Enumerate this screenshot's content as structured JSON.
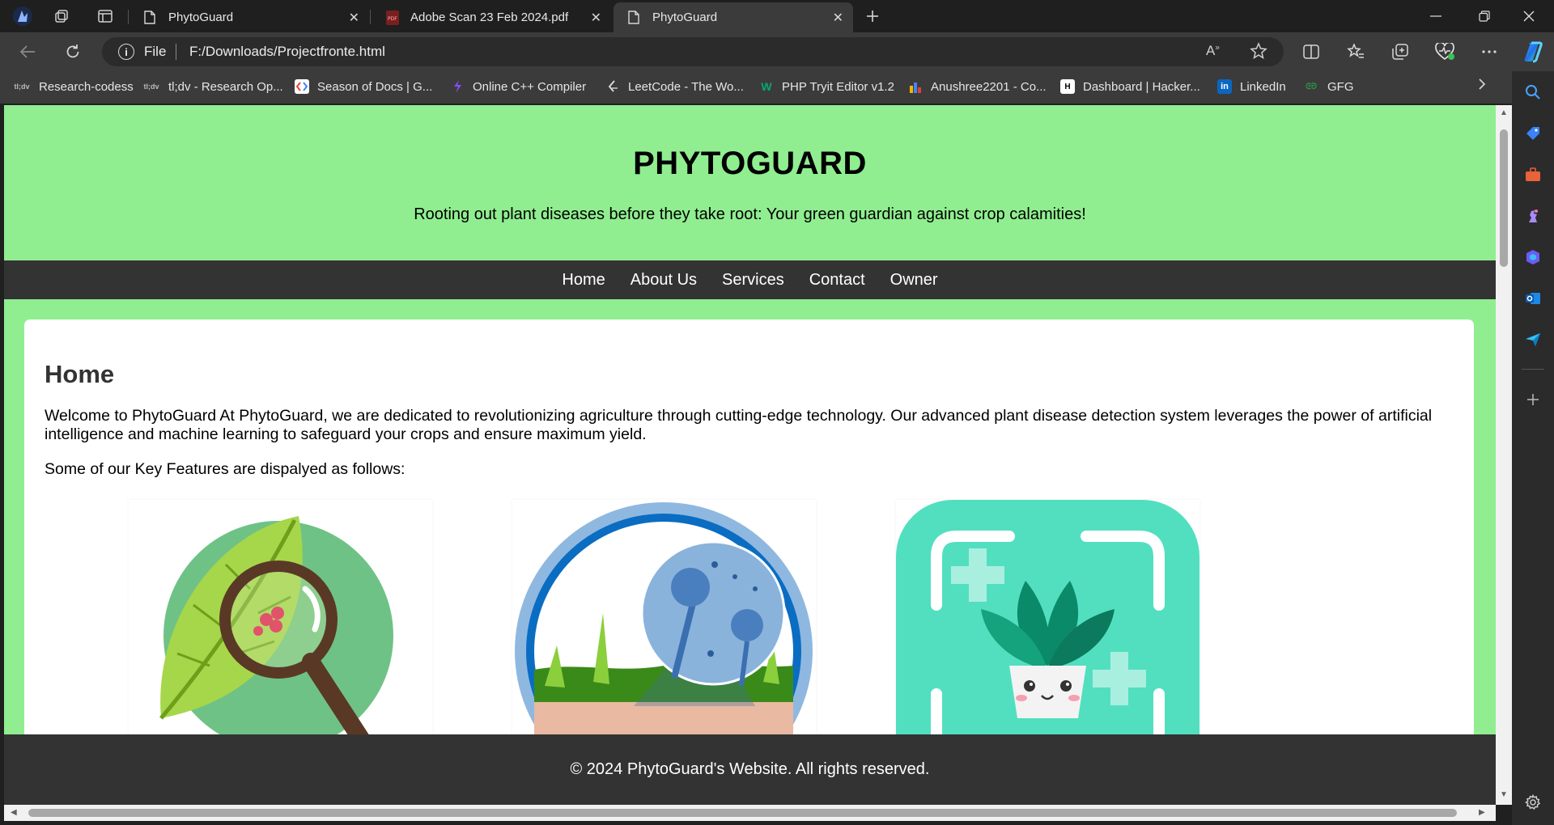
{
  "browser": {
    "tabs": [
      {
        "title": "PhytoGuard",
        "icon": "page-icon",
        "active": false
      },
      {
        "title": "Adobe Scan 23 Feb 2024.pdf",
        "icon": "pdf-icon",
        "active": false
      },
      {
        "title": "PhytoGuard",
        "icon": "page-icon",
        "active": true
      }
    ],
    "address": {
      "scheme_label": "File",
      "url": "F:/Downloads/Projectfronte.html"
    },
    "favorites": [
      {
        "label": "Research-codess",
        "icon": "tldv-icon"
      },
      {
        "label": "tl;dv - Research Op...",
        "icon": "tldv-icon"
      },
      {
        "label": "Season of Docs  |  G...",
        "icon": "google-icon"
      },
      {
        "label": "Online C++ Compiler",
        "icon": "compiler-icon"
      },
      {
        "label": "LeetCode - The Wo...",
        "icon": "leetcode-icon"
      },
      {
        "label": "PHP Tryit Editor v1.2",
        "icon": "w3schools-icon"
      },
      {
        "label": "Anushree2201 - Co...",
        "icon": "chart-icon"
      },
      {
        "label": "Dashboard | Hacker...",
        "icon": "hackerrank-icon"
      },
      {
        "label": "LinkedIn",
        "icon": "linkedin-icon"
      },
      {
        "label": "GFG",
        "icon": "gfg-icon"
      }
    ]
  },
  "site": {
    "title": "PHYTOGUARD",
    "tagline": "Rooting out plant diseases before they take root: Your green guardian against crop calamities!",
    "nav": [
      "Home",
      "About Us",
      "Services",
      "Contact",
      "Owner"
    ],
    "section_title": "Home",
    "intro": "Welcome to PhytoGuard At PhytoGuard, we are dedicated to revolutionizing agriculture through cutting-edge technology. Our advanced plant disease detection system leverages the power of artificial intelligence and machine learning to safeguard your crops and ensure maximum yield.",
    "features_intro": "Some of our Key Features are dispalyed as follows:",
    "features": [
      {
        "icon": "leaf-magnifier-icon"
      },
      {
        "icon": "microscope-fungus-icon"
      },
      {
        "icon": "plant-scan-icon"
      }
    ],
    "footer": "© 2024 PhytoGuard's Website. All rights reserved."
  },
  "colors": {
    "header_bg": "#90ee90",
    "nav_bg": "#333333",
    "browser_chrome": "#3b3b3b"
  }
}
